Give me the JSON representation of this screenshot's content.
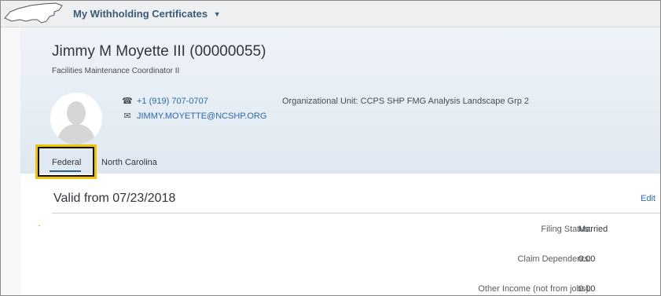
{
  "shell": {
    "app_title": "My Withholding Certificates"
  },
  "employee": {
    "name": "Jimmy M Moyette III (00000055)",
    "role": "Facilities Maintenance Coordinator II",
    "phone": "+1 (919) 707-0707",
    "email": "JIMMY.MOYETTE@NCSHP.ORG",
    "org_unit": "Organizational Unit: CCPS SHP FMG Analysis Landscape Grp 2"
  },
  "tabs": [
    {
      "label": "Federal",
      "selected": true
    },
    {
      "label": "North Carolina",
      "selected": false
    }
  ],
  "section": {
    "title": "Valid from 07/23/2018",
    "edit_label": "Edit"
  },
  "fields": [
    {
      "label": "Filing Status:",
      "value": "Married"
    },
    {
      "label": "Claim Dependents:",
      "value": "0.00"
    },
    {
      "label": "Other Income (not from jobs):",
      "value": "0.00"
    }
  ],
  "colors": {
    "link": "#2a6bb1",
    "highlight_box": "#f2c300",
    "tab_underline": "#346187"
  },
  "icons": {
    "logo": "nc-state-outline",
    "caret": "caret-down-icon",
    "phone": "phone-icon",
    "email": "envelope-icon",
    "avatar": "person-placeholder"
  }
}
